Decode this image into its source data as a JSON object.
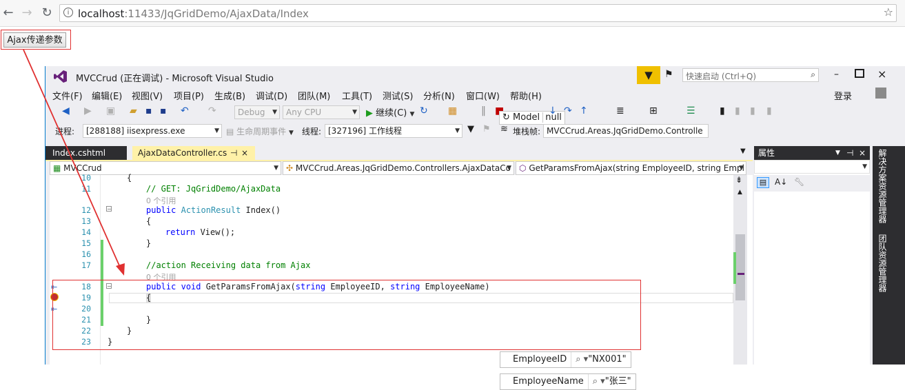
{
  "browser": {
    "back": "←",
    "forward": "→",
    "reload": "↻",
    "url_host": "localhost",
    "url_path": ":11433/JqGridDemo/AjaxData/Index",
    "star": "☆"
  },
  "page": {
    "ajax_button_label": "Ajax传递参数"
  },
  "vs": {
    "title": "MVCCrud (正在调试) - Microsoft Visual Studio",
    "quick_launch_placeholder": "快速启动 (Ctrl+Q)",
    "menu": [
      "文件(F)",
      "编辑(E)",
      "视图(V)",
      "项目(P)",
      "生成(B)",
      "调试(D)",
      "团队(M)",
      "工具(T)",
      "测试(S)",
      "分析(N)",
      "窗口(W)",
      "帮助(H)"
    ],
    "login": "登录",
    "toolbar": {
      "config": "Debug",
      "platform": "Any CPU",
      "continue": "继续(C)",
      "tooltip_model": "Model",
      "tooltip_null": "null"
    },
    "debug_bar": {
      "process_label": "进程:",
      "process": "[288188] iisexpress.exe",
      "lifecycle": "生命周期事件",
      "thread_label": "线程:",
      "thread": "[327196] 工作线程",
      "stack_label": "堆栈帧:",
      "stack": "MVCCrud.Areas.JqGridDemo.Controlle"
    },
    "tabs": [
      {
        "label": "Index.cshtml"
      },
      {
        "label": "AjaxDataController.cs",
        "pin": "⊣",
        "close": "×"
      }
    ],
    "nav": {
      "project": "MVCCrud",
      "class": "MVCCrud.Areas.JqGridDemo.Controllers.AjaxDataCo",
      "member": "GetParamsFromAjax(string EmployeeID, string Empl"
    },
    "code_lines": [
      {
        "n": "10",
        "text": "{"
      },
      {
        "n": "11",
        "text": "// GET: JqGridDemo/AjaxData"
      },
      {
        "n": "",
        "text": "0 个引用"
      },
      {
        "n": "12",
        "text": "public ActionResult Index()"
      },
      {
        "n": "13",
        "text": "{"
      },
      {
        "n": "14",
        "text": "return View();"
      },
      {
        "n": "15",
        "text": "}"
      },
      {
        "n": "16",
        "text": ""
      },
      {
        "n": "17",
        "text": "//action Receiving data from Ajax"
      },
      {
        "n": "",
        "text": "0 个引用"
      },
      {
        "n": "18",
        "text": "public void GetParamsFromAjax(string EmployeeID, string EmployeeName)"
      },
      {
        "n": "19",
        "text": "{"
      },
      {
        "n": "20",
        "text": ""
      },
      {
        "n": "21",
        "text": "}"
      },
      {
        "n": "22",
        "text": "}"
      },
      {
        "n": "23",
        "text": "}"
      }
    ],
    "datatips": [
      {
        "name": "EmployeeID",
        "value": "\"NX001\""
      },
      {
        "name": "EmployeeName",
        "value": "\"张三\""
      }
    ],
    "properties": {
      "title": "属性"
    },
    "side_rail": [
      "解决方案资源管理器",
      "团队资源管理器"
    ]
  },
  "colors": {
    "accent": "#007acc",
    "annotation": "#e03030",
    "tab_active": "#fff1a8"
  }
}
